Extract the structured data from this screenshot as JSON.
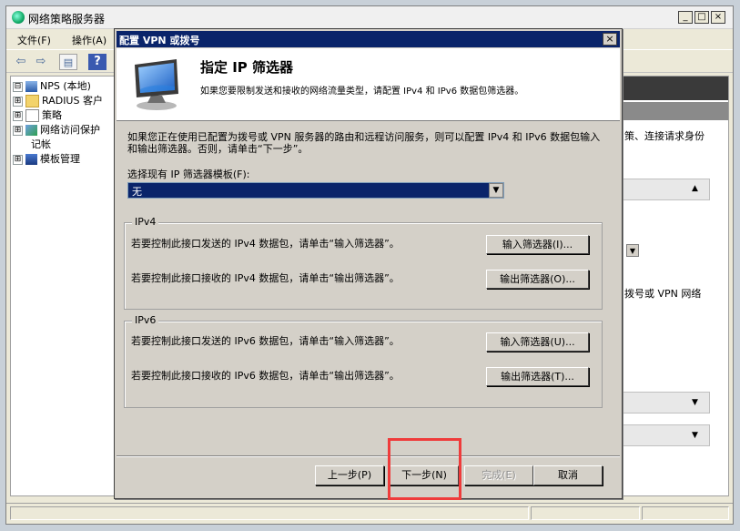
{
  "main_window": {
    "title": "网络策略服务器",
    "controls": {
      "minimize": "_",
      "maximize": "□",
      "close": "×"
    },
    "menu": [
      "文件(F)",
      "操作(A)"
    ],
    "toolbar_icons": [
      "back-arrow-icon",
      "forward-arrow-icon",
      "console-tree-icon",
      "help-icon"
    ],
    "tree": [
      {
        "label": "NPS (本地)",
        "expander": "⊟",
        "icon": "nps-server-icon"
      },
      {
        "label": "RADIUS 客户",
        "expander": "⊞",
        "icon": "folder-icon"
      },
      {
        "label": "策略",
        "expander": "⊞",
        "icon": "policy-icon"
      },
      {
        "label": "网络访问保护",
        "expander": "⊞",
        "icon": "nap-icon"
      },
      {
        "label": "记帐",
        "expander": "",
        "icon": "accounting-icon"
      },
      {
        "label": "模板管理",
        "expander": "⊞",
        "icon": "template-icon"
      }
    ],
    "right_pane_fragments": [
      "策、连接请求身份",
      "拨号或 VPN 网络"
    ]
  },
  "dialog": {
    "title": "配置 VPN 或拨号",
    "close_glyph": "×",
    "heading": "指定 IP 筛选器",
    "subheading": "如果您要限制发送和接收的网络流量类型，请配置 IPv4 和 IPv6 数据包筛选器。",
    "intro_line1": "如果您正在使用已配置为拨号或 VPN 服务器的路由和远程访问服务，则可以配置 IPv4 和 IPv6 数据包输入",
    "intro_line2": "和输出筛选器。否则，请单击“下一步”。",
    "template_label": "选择现有 IP 筛选器模板(F):",
    "template_value": "无",
    "ipv4": {
      "legend": "IPv4",
      "line_in": "若要控制此接口发送的 IPv4 数据包，请单击“输入筛选器”。",
      "btn_in": "输入筛选器(I)...",
      "line_out": "若要控制此接口接收的 IPv4 数据包，请单击“输出筛选器”。",
      "btn_out": "输出筛选器(O)..."
    },
    "ipv6": {
      "legend": "IPv6",
      "line_in": "若要控制此接口发送的 IPv6 数据包，请单击“输入筛选器”。",
      "btn_in": "输入筛选器(U)...",
      "line_out": "若要控制此接口接收的 IPv6 数据包，请单击“输出筛选器”。",
      "btn_out": "输出筛选器(T)..."
    },
    "buttons": {
      "back": "上一步(P)",
      "next": "下一步(N)",
      "finish": "完成(E)",
      "cancel": "取消"
    }
  },
  "colors": {
    "dialog_title_bar": "#0a246a",
    "highlight": "#ef3b3b",
    "face": "#d4d0c8"
  }
}
